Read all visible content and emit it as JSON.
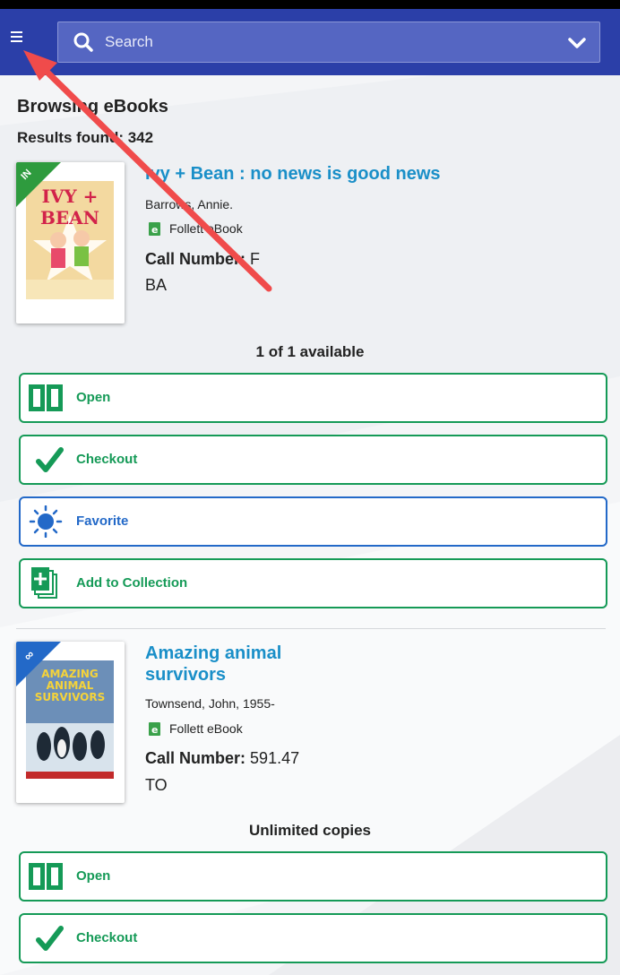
{
  "search": {
    "placeholder": "Search"
  },
  "page": {
    "title": "Browsing eBooks",
    "results": "Results found: 342"
  },
  "records": [
    {
      "title": "Ivy + Bean : no news is good news",
      "author": "Barrows, Annie.",
      "format": "Follett eBook",
      "call_label": "Call Number:",
      "call_value": "F",
      "call_suffix": "BA",
      "ribbon": "IN",
      "ribbon_color": "#2e9b3e",
      "availability": "1 of 1 available",
      "cover_text": "IVY + BEAN",
      "actions": [
        "Open",
        "Checkout",
        "Favorite",
        "Add to Collection"
      ]
    },
    {
      "title": "Amazing animal survivors",
      "author": "Townsend, John, 1955-",
      "format": "Follett eBook",
      "call_label": "Call Number:",
      "call_value": "591.47",
      "call_suffix": "TO",
      "ribbon": "∞",
      "ribbon_color": "#2369c8",
      "availability": "Unlimited copies",
      "cover_text": "AMAZING ANIMAL SURVIVORS",
      "actions": [
        "Open",
        "Checkout"
      ]
    }
  ],
  "colors": {
    "appbar": "#2b3fa8",
    "link": "#1a8fc8",
    "action_green": "#159a57",
    "action_blue": "#2369c8",
    "annotation_arrow": "#f04b4b"
  },
  "icons": [
    "menu-icon",
    "search-icon",
    "chevron-down-icon",
    "open-book-icon",
    "checkmark-icon",
    "sun-icon",
    "add-collection-icon",
    "follett-ebook-icon",
    "infinity-icon"
  ]
}
